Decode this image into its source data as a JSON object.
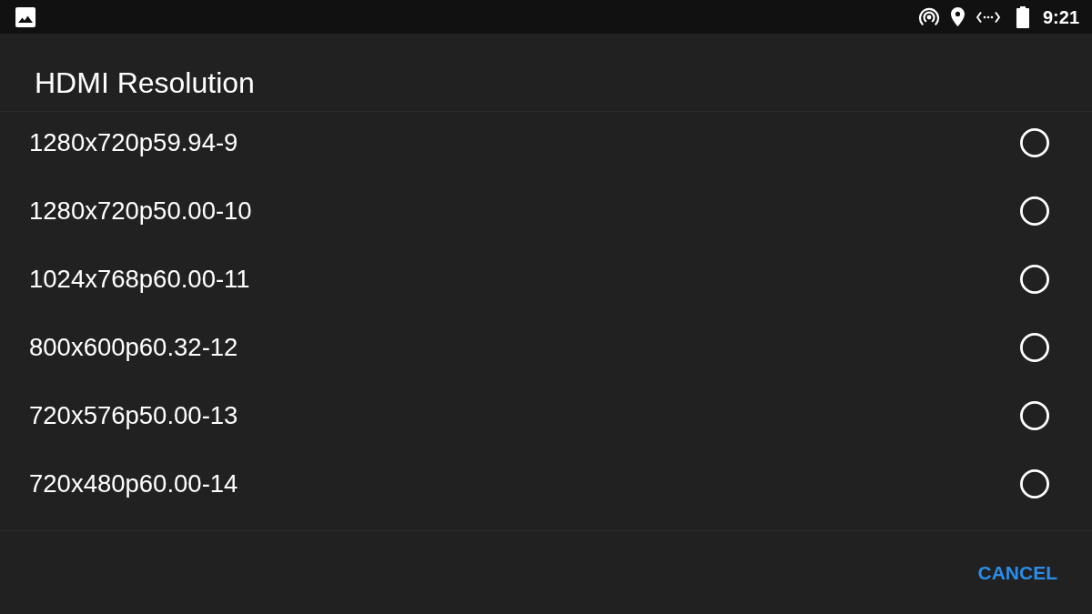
{
  "status_bar": {
    "time": "9:21"
  },
  "dialog": {
    "title": "HDMI Resolution",
    "options": [
      {
        "label": "1280x720p59.94-9",
        "selected": false
      },
      {
        "label": "1280x720p50.00-10",
        "selected": false
      },
      {
        "label": "1024x768p60.00-11",
        "selected": false
      },
      {
        "label": "800x600p60.32-12",
        "selected": false
      },
      {
        "label": "720x576p50.00-13",
        "selected": false
      },
      {
        "label": "720x480p60.00-14",
        "selected": false
      }
    ],
    "buttons": [
      {
        "label": "CANCEL"
      }
    ]
  }
}
